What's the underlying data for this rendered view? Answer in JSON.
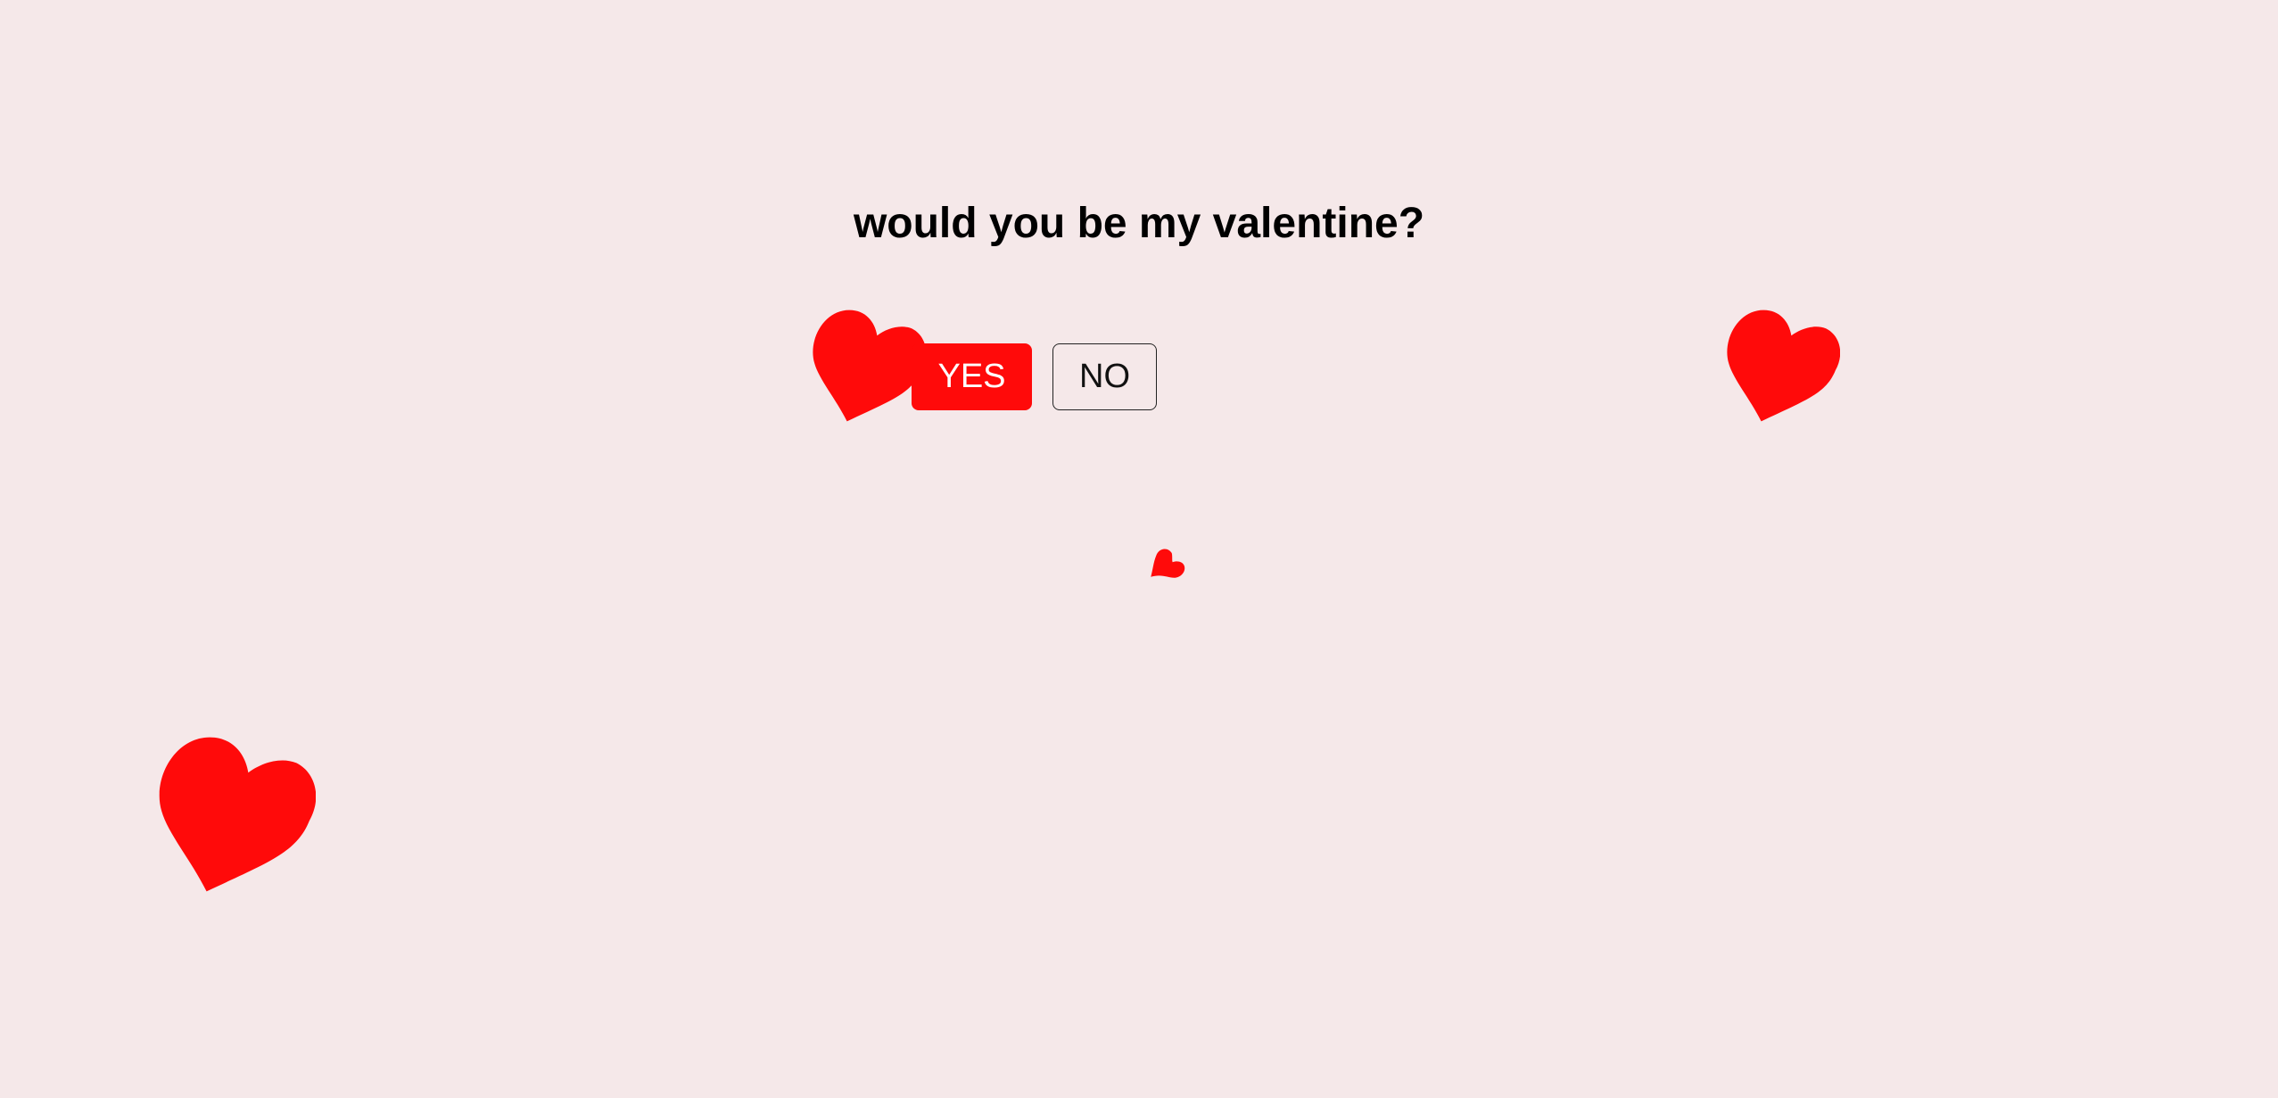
{
  "question": "would you be my valentine?",
  "buttons": {
    "yes_label": "YES",
    "no_label": "NO"
  },
  "colors": {
    "background": "#f5e8e9",
    "heart": "#ff0a0a",
    "yes_button": "#ff0a0a",
    "text": "#000000"
  },
  "hearts": [
    {
      "icon": "heart-icon"
    },
    {
      "icon": "heart-icon"
    },
    {
      "icon": "heart-icon"
    },
    {
      "icon": "heart-icon"
    }
  ]
}
